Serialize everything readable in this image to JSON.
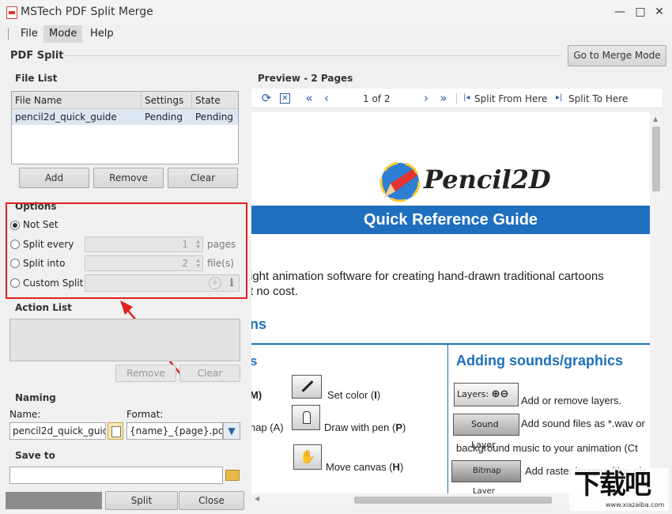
{
  "window": {
    "title": "MSTech PDF Split Merge",
    "minimize": "—",
    "maximize": "□",
    "close": "✕"
  },
  "menu": [
    {
      "label": "File"
    },
    {
      "label": "Mode"
    },
    {
      "label": "Help"
    }
  ],
  "header": {
    "mode_title": "PDF Split",
    "switch_button": "Go to Merge Mode"
  },
  "file_list": {
    "title": "File List",
    "columns": [
      "File Name",
      "Settings",
      "State"
    ],
    "rows": [
      {
        "name": "pencil2d_quick_guide",
        "settings": "Pending",
        "state": "Pending"
      }
    ],
    "buttons": {
      "add": "Add",
      "remove": "Remove",
      "clear": "Clear"
    }
  },
  "options": {
    "title": "Options",
    "not_set": "Not Set",
    "split_every": {
      "label": "Split every",
      "value": "1",
      "unit": "pages"
    },
    "split_into": {
      "label": "Split into",
      "value": "2",
      "unit": "file(s)"
    },
    "custom_split": {
      "label": "Custom Split",
      "value": ""
    },
    "selected": "not_set"
  },
  "action_list": {
    "title": "Action List",
    "remove": "Remove",
    "clear": "Clear"
  },
  "naming": {
    "title": "Naming",
    "name_label": "Name:",
    "name_value": "pencil2d_quick_guide",
    "format_label": "Format:",
    "format_value": "{name}_{page}.pdf"
  },
  "save_to": {
    "title": "Save to",
    "value": ""
  },
  "bottom": {
    "split": "Split",
    "close": "Close"
  },
  "preview": {
    "title": "Preview - 2 Pages",
    "page_indicator": "1 of 2",
    "split_from_here": "Split From Here",
    "split_to_here": "Split To Here"
  },
  "document": {
    "logo_text": "Pencil2D",
    "banner": "Quick Reference Guide",
    "intro_line1": "ight animation software for creating hand-drawn traditional cartoons",
    "intro_line2": "t no cost.",
    "section_fragment": "ns",
    "left_col_fragment": "s",
    "right_col_heading": "Adding sounds/graphics",
    "left_rows": [
      {
        "prefix": "M)",
        "text_before": "Set color (",
        "key": "I",
        "text_after": ")"
      },
      {
        "prefix": "nap (A)",
        "text_before": "Draw with pen (",
        "key": "P",
        "text_after": ")"
      },
      {
        "prefix": "",
        "text_before": "Move canvas (",
        "key": "H",
        "text_after": ")"
      }
    ],
    "right_rows": [
      {
        "badge": "Layers:",
        "text": "Add or remove layers."
      },
      {
        "badge": "Sound Layer",
        "text": "Add sound files as *.wav or"
      },
      {
        "badge": "",
        "text": "background music to your animation (Ct"
      },
      {
        "badge": "Bitmap Layer",
        "text": "Add raster images (tiny pix"
      }
    ],
    "brand_blue": "#1f6fbf"
  },
  "watermark": {
    "logo": "下载吧",
    "url": "www.xiazaiba.com"
  },
  "colors": {
    "highlight": "#e02020",
    "accent": "#2a5ea8",
    "selected_row": "#dde7f3"
  }
}
